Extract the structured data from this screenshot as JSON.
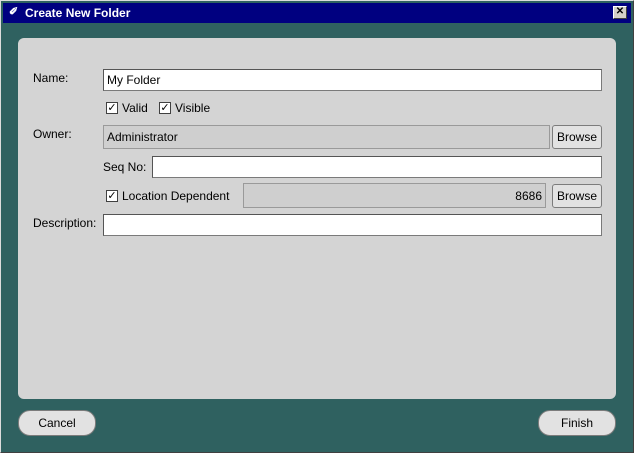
{
  "window": {
    "title": "Create New Folder",
    "close_glyph": "✕"
  },
  "form": {
    "name_label": "Name:",
    "name_value": "My Folder",
    "valid_label": "Valid",
    "visible_label": "Visible",
    "owner_label": "Owner:",
    "owner_value": "Administrator",
    "browse_label": "Browse",
    "seq_label": "Seq No:",
    "seq_value": "",
    "location_label": "Location Dependent",
    "location_value": "8686",
    "description_label": "Description:",
    "description_value": ""
  },
  "footer": {
    "cancel_label": "Cancel",
    "finish_label": "Finish"
  },
  "check_glyph": "✓"
}
